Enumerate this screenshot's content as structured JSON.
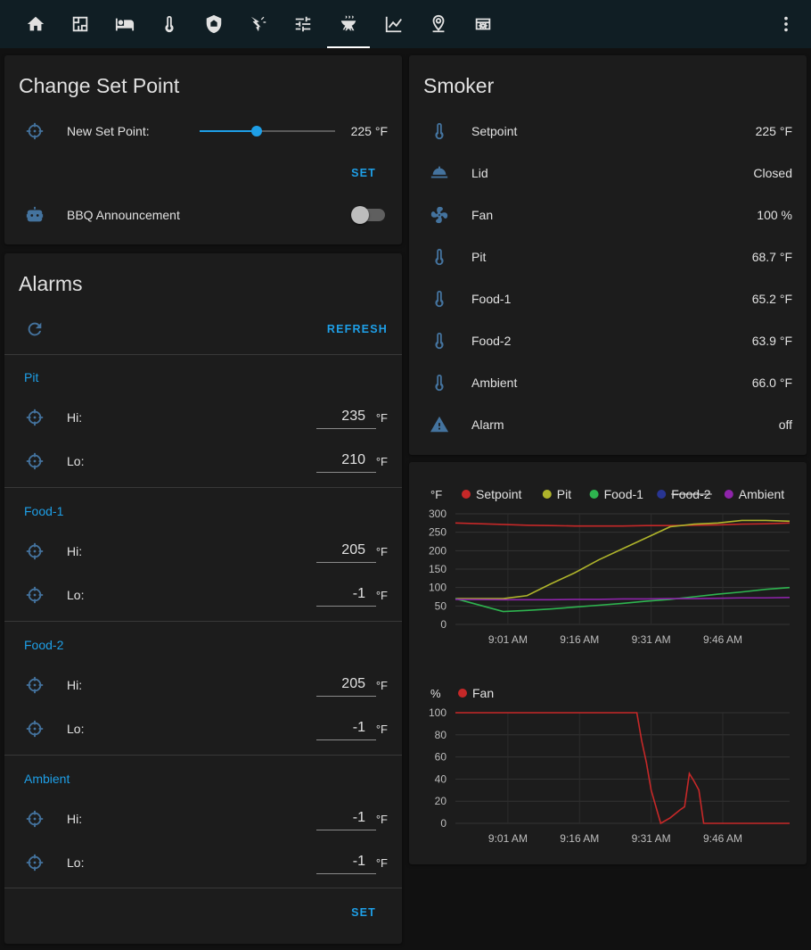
{
  "nav": {
    "tabs": [
      {
        "icon": "home-icon"
      },
      {
        "icon": "floorplan-icon"
      },
      {
        "icon": "bed-icon"
      },
      {
        "icon": "thermometer-icon"
      },
      {
        "icon": "security-icon"
      },
      {
        "icon": "power-icon"
      },
      {
        "icon": "tune-icon"
      },
      {
        "icon": "grill-icon",
        "active": true
      },
      {
        "icon": "chart-icon"
      },
      {
        "icon": "map-marker-icon"
      },
      {
        "icon": "robot-vacuum-icon"
      }
    ],
    "menu_icon": "dots-vertical-icon"
  },
  "setpoint_card": {
    "title": "Change Set Point",
    "new_set_point_label": "New Set Point:",
    "new_set_point_value": "225 °F",
    "slider_fraction": 0.42,
    "set_label": "SET",
    "announcement_label": "BBQ Announcement",
    "announcement_on": false
  },
  "alarms_card": {
    "title": "Alarms",
    "refresh_label": "REFRESH",
    "groups": [
      {
        "name": "Pit",
        "hi_label": "Hi:",
        "hi": "235",
        "lo_label": "Lo:",
        "lo": "210",
        "unit": "°F"
      },
      {
        "name": "Food-1",
        "hi_label": "Hi:",
        "hi": "205",
        "lo_label": "Lo:",
        "lo": "-1",
        "unit": "°F"
      },
      {
        "name": "Food-2",
        "hi_label": "Hi:",
        "hi": "205",
        "lo_label": "Lo:",
        "lo": "-1",
        "unit": "°F"
      },
      {
        "name": "Ambient",
        "hi_label": "Hi:",
        "hi": "-1",
        "lo_label": "Lo:",
        "lo": "-1",
        "unit": "°F"
      }
    ],
    "set_label": "SET"
  },
  "smoker_card": {
    "title": "Smoker",
    "rows": [
      {
        "icon": "thermometer-icon",
        "label": "Setpoint",
        "value": "225 °F"
      },
      {
        "icon": "lid-icon",
        "label": "Lid",
        "value": "Closed"
      },
      {
        "icon": "fan-icon",
        "label": "Fan",
        "value": "100 %"
      },
      {
        "icon": "thermometer-icon",
        "label": "Pit",
        "value": "68.7 °F"
      },
      {
        "icon": "thermometer-icon",
        "label": "Food-1",
        "value": "65.2 °F"
      },
      {
        "icon": "thermometer-icon",
        "label": "Food-2",
        "value": "63.9 °F"
      },
      {
        "icon": "thermometer-icon",
        "label": "Ambient",
        "value": "66.0 °F"
      },
      {
        "icon": "alert-icon",
        "label": "Alarm",
        "value": "off"
      }
    ]
  },
  "colors": {
    "accent": "#1e9fe7",
    "icon": "#44739e",
    "setpoint": "#c62828",
    "pit": "#afb42b",
    "food1": "#2eb44f",
    "food2": "#283593",
    "ambient": "#8e24aa",
    "fan": "#c62828"
  },
  "chart_data": [
    {
      "type": "line",
      "ylabel": "°F",
      "ylim": [
        0,
        300
      ],
      "yticks": [
        0,
        50,
        100,
        150,
        200,
        250,
        300
      ],
      "xticks": [
        "9:01 AM",
        "9:16 AM",
        "9:31 AM",
        "9:46 AM"
      ],
      "x_minutes_after_9am": [
        -10,
        0,
        5,
        10,
        15,
        20,
        25,
        30,
        35,
        40,
        45,
        50,
        55,
        60
      ],
      "series": [
        {
          "name": "Setpoint",
          "color": "#c62828",
          "hidden": false,
          "values": [
            275,
            271,
            269,
            268,
            267,
            267,
            267,
            268,
            268,
            269,
            270,
            272,
            273,
            275
          ]
        },
        {
          "name": "Pit",
          "color": "#afb42b",
          "hidden": false,
          "values": [
            70,
            70,
            78,
            110,
            140,
            175,
            205,
            235,
            265,
            272,
            275,
            282,
            282,
            280
          ]
        },
        {
          "name": "Food-1",
          "color": "#2eb44f",
          "hidden": false,
          "values": [
            70,
            35,
            38,
            42,
            47,
            52,
            57,
            63,
            68,
            75,
            82,
            88,
            95,
            100
          ]
        },
        {
          "name": "Food-2",
          "color": "#283593",
          "hidden": true,
          "values": []
        },
        {
          "name": "Ambient",
          "color": "#8e24aa",
          "hidden": false,
          "values": [
            68,
            67,
            67,
            67,
            68,
            68,
            69,
            69,
            70,
            70,
            71,
            72,
            72,
            73
          ]
        }
      ]
    },
    {
      "type": "line",
      "ylabel": "%",
      "ylim": [
        0,
        100
      ],
      "yticks": [
        0,
        20,
        40,
        60,
        80,
        100
      ],
      "xticks": [
        "9:01 AM",
        "9:16 AM",
        "9:31 AM",
        "9:46 AM"
      ],
      "x_minutes_after_9am": [
        -10,
        0,
        10,
        20,
        28,
        29,
        30,
        31,
        33,
        35,
        37,
        38,
        39,
        40,
        41,
        42,
        43,
        44,
        60
      ],
      "series": [
        {
          "name": "Fan",
          "color": "#c62828",
          "hidden": false,
          "values": [
            100,
            100,
            100,
            100,
            100,
            75,
            55,
            30,
            0,
            5,
            12,
            15,
            45,
            38,
            30,
            0,
            0,
            0,
            0
          ]
        }
      ]
    }
  ]
}
